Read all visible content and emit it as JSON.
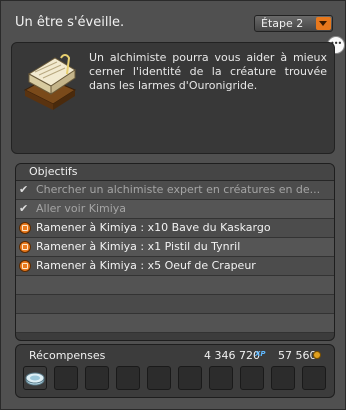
{
  "quest": {
    "title": "Un être s'éveille.",
    "step_label": "Étape 2",
    "description": "Un alchimiste pourra vous aider à mieux cerner l'identité de la créature trouvée dans les larmes d'Ouronigride."
  },
  "objectives": {
    "header": "Objectifs",
    "items": [
      {
        "label": "Chercher un alchimiste expert en créatures en de...",
        "status": "done",
        "icon": "check-icon"
      },
      {
        "label": "Aller voir Kimiya",
        "status": "done",
        "icon": "check-icon"
      },
      {
        "label": "Ramener à Kimiya : x10 Bave du Kaskargo",
        "status": "active",
        "icon": "objective-icon"
      },
      {
        "label": "Ramener à Kimiya : x1 Pistil du Tynril",
        "status": "active",
        "icon": "objective-icon"
      },
      {
        "label": "Ramener à Kimiya : x5 Oeuf de Crapeur",
        "status": "active",
        "icon": "objective-icon"
      }
    ]
  },
  "rewards": {
    "label": "Récompenses",
    "xp": "4 346 720",
    "xp_tag": "XP",
    "kamas": "57 560",
    "slots": [
      "item-reward",
      "",
      "",
      "",
      "",
      "",
      "",
      "",
      "",
      ""
    ]
  },
  "colors": {
    "accent": "#e8781c",
    "xp": "#5fb8ff",
    "kamas": "#e0a020"
  }
}
